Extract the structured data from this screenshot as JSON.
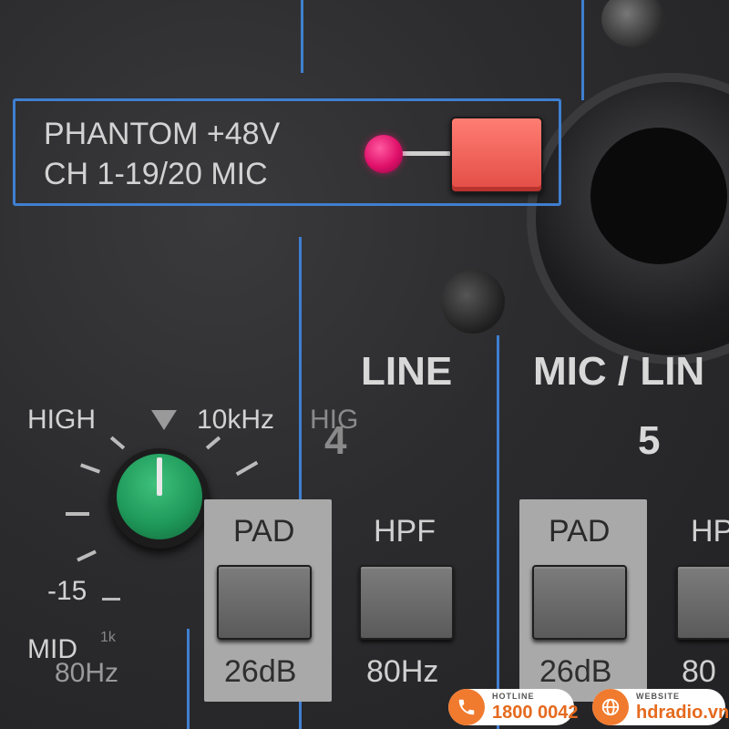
{
  "phantom": {
    "line1": "PHANTOM  +48V",
    "line2": "CH 1-19/20  MIC",
    "led_color": "#e0106a",
    "button_color": "#e8554c"
  },
  "channel4": {
    "type_label": "LINE",
    "number": "4",
    "pad_label": "PAD",
    "pad_value": "26dB",
    "hpf_label": "HPF",
    "hpf_value": "80Hz"
  },
  "channel5": {
    "type_label": "MIC / LIN",
    "number": "5",
    "pad_label": "PAD",
    "pad_value": "26dB",
    "hpf_label": "HP",
    "hpf_value": "80"
  },
  "eq_knob": {
    "label_high": "HIGH",
    "freq": "10kHz",
    "label_high_partial": "HIG",
    "min_value": "-15",
    "mid_label": "MID",
    "mid_freq": "80Hz",
    "mid_freq_partial": "1k",
    "knob_color": "#1f9a5a"
  },
  "watermark": {
    "hotline_caption": "HOTLINE",
    "hotline_number": "1800 0042",
    "website_caption": "WEBSITE",
    "website_url": "hdradio.vn",
    "accent": "#f07a2e"
  }
}
